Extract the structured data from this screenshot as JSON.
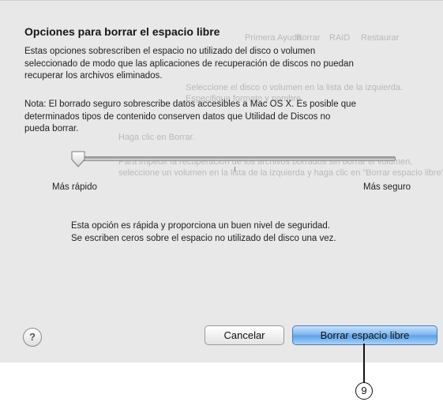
{
  "dialog": {
    "title": "Opciones para borrar el espacio libre",
    "intro_lines": [
      "Estas opciones sobrescriben el espacio no utilizado del disco o volumen",
      "seleccionado de modo que las aplicaciones de recuperación de discos no puedan",
      "recuperar los archivos eliminados."
    ],
    "note_lines": [
      "Nota: El borrado seguro sobrescribe datos accesibles a Mac OS X. Es posible que",
      "determinados tipos de contenido conserven datos que Utilidad de Discos no",
      "pueda borrar."
    ],
    "slider": {
      "min_label": "Más rápido",
      "max_label": "Más seguro",
      "level_fraction": 0.0
    },
    "description_lines": [
      "Esta opción es rápida y proporciona un buen nivel de seguridad.",
      "Se escriben ceros sobre el espacio no utilizado del disco una vez."
    ],
    "help_label": "?",
    "cancel_label": "Cancelar",
    "primary_label": "Borrar espacio libre"
  },
  "background_ghost": {
    "tabs": [
      "Primera Ayuda",
      "Borrar",
      "RAID",
      "Restaurar"
    ],
    "line1": "Seleccione el disco o volumen en la lista de la izquierda.",
    "line2": "Especifique formato y nombre.",
    "line3": "Haga clic en Borrar.",
    "line4": "Para impedir la recuperación de los archivos borrados sin borrar el volumen,",
    "line5": "seleccione un volumen en la lista de la izquierda y haga clic en \"Borrar espacio libre\"."
  },
  "callout": {
    "number": "9"
  },
  "colors": {
    "sheet_bg": "#e8e8e8",
    "primary_button": "#79b4ee",
    "text": "#1e1e1e"
  }
}
